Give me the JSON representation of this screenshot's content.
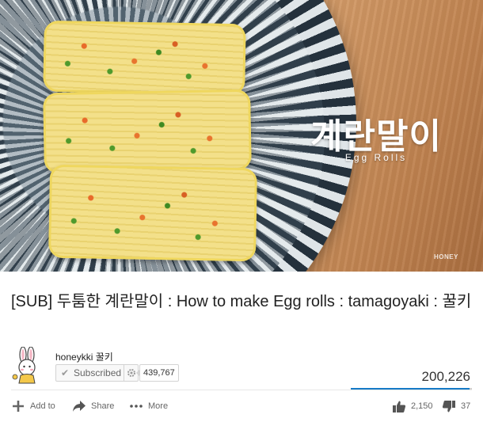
{
  "video": {
    "overlay_title": "계란말이",
    "overlay_subtitle": "Egg Rolls",
    "watermark": "HONEY",
    "title": "[SUB] 두툼한 계란말이 : How to make Egg rolls : tamagoyaki : 꿀키"
  },
  "channel": {
    "name": "honeykki 꿀키",
    "subscribed_label": "Subscribed",
    "subscriber_count": "439,767"
  },
  "stats": {
    "views": "200,226",
    "like_fraction": 0.98,
    "likes": "2,150",
    "dislikes": "37"
  },
  "actions": {
    "add_to": "Add to",
    "share": "Share",
    "more": "More"
  },
  "colors": {
    "accent": "#167ac6",
    "text": "#222222",
    "muted": "#666666"
  },
  "icons": {
    "add": "plus-icon",
    "share": "share-arrow-icon",
    "more": "more-dots-icon",
    "like": "thumbs-up-icon",
    "dislike": "thumbs-down-icon",
    "settings": "gear-icon",
    "subscribed": "check-icon"
  }
}
